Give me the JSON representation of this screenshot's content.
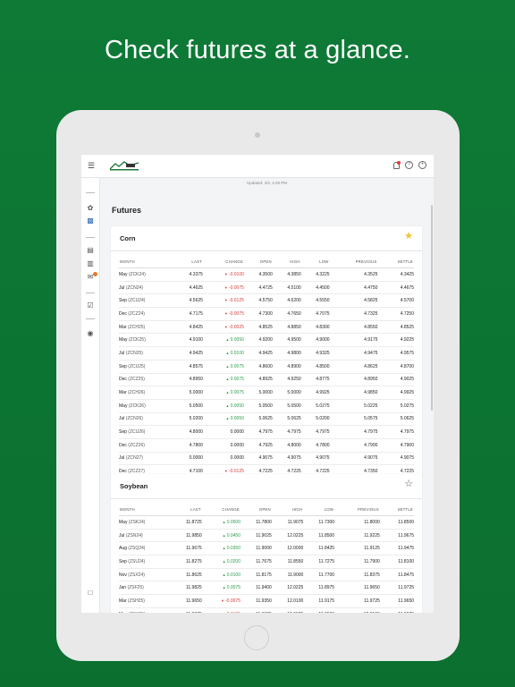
{
  "headline": "Check futures at a glance.",
  "app": {
    "updated": "Updated: 4/3, 4:29 PM",
    "page_title": "Futures",
    "logo_alt": "Daily BOSS"
  },
  "columns": [
    "MONTH",
    "LAST",
    "CHANGE",
    "OPEN",
    "HIGH",
    "LOW",
    "PREVIOUS",
    "SETTLE"
  ],
  "cards": [
    {
      "title": "Corn",
      "favorite": true,
      "rows": [
        {
          "month": "May",
          "code": "(ZCK24)",
          "last": "4.3375",
          "change": "-0.0100",
          "dir": "down",
          "open": "4.3500",
          "high": "4.3850",
          "low": "4.3225",
          "previous": "4.3525",
          "settle": "4.3425"
        },
        {
          "month": "Jul",
          "code": "(ZCN24)",
          "last": "4.4625",
          "change": "-0.0075",
          "dir": "down",
          "open": "4.4725",
          "high": "4.5100",
          "low": "4.4500",
          "previous": "4.4750",
          "settle": "4.4675"
        },
        {
          "month": "Sep",
          "code": "(ZCU24)",
          "last": "4.5625",
          "change": "-0.0125",
          "dir": "down",
          "open": "4.5750",
          "high": "4.6200",
          "low": "4.5550",
          "previous": "4.5825",
          "settle": "4.5700"
        },
        {
          "month": "Dec",
          "code": "(ZCZ24)",
          "last": "4.7175",
          "change": "-0.0075",
          "dir": "down",
          "open": "4.7300",
          "high": "4.7650",
          "low": "4.7075",
          "previous": "4.7325",
          "settle": "4.7250"
        },
        {
          "month": "Mar",
          "code": "(ZCH25)",
          "last": "4.8425",
          "change": "-0.0025",
          "dir": "down",
          "open": "4.8525",
          "high": "4.8850",
          "low": "4.8300",
          "previous": "4.8550",
          "settle": "4.8525"
        },
        {
          "month": "May",
          "code": "(ZCK25)",
          "last": "4.9100",
          "change": "0.0050",
          "dir": "up",
          "open": "4.9200",
          "high": "4.9500",
          "low": "4.9000",
          "previous": "4.9175",
          "settle": "4.9225"
        },
        {
          "month": "Jul",
          "code": "(ZCN25)",
          "last": "4.9425",
          "change": "0.0100",
          "dir": "up",
          "open": "4.9425",
          "high": "4.9800",
          "low": "4.9325",
          "previous": "4.9475",
          "settle": "4.9575"
        },
        {
          "month": "Sep",
          "code": "(ZCU25)",
          "last": "4.8575",
          "change": "0.0075",
          "dir": "up",
          "open": "4.8600",
          "high": "4.8900",
          "low": "4.8500",
          "previous": "4.8625",
          "settle": "4.8700"
        },
        {
          "month": "Dec",
          "code": "(ZCZ25)",
          "last": "4.8950",
          "change": "0.0075",
          "dir": "up",
          "open": "4.8925",
          "high": "4.9250",
          "low": "4.8775",
          "previous": "4.8950",
          "settle": "4.9025"
        },
        {
          "month": "Mar",
          "code": "(ZCH26)",
          "last": "5.0000",
          "change": "0.0075",
          "dir": "up",
          "open": "5.0000",
          "high": "5.0000",
          "low": "4.9925",
          "previous": "4.9850",
          "settle": "4.9925"
        },
        {
          "month": "May",
          "code": "(ZCK26)",
          "last": "5.0500",
          "change": "0.0050",
          "dir": "up",
          "open": "5.0500",
          "high": "5.0500",
          "low": "5.0275",
          "previous": "5.0225",
          "settle": "5.0275"
        },
        {
          "month": "Jul",
          "code": "(ZCN26)",
          "last": "5.0200",
          "change": "0.0050",
          "dir": "up",
          "open": "5.0625",
          "high": "5.0625",
          "low": "5.0200",
          "previous": "5.0575",
          "settle": "5.0625"
        },
        {
          "month": "Sep",
          "code": "(ZCU26)",
          "last": "4.8000",
          "change": "0.0000",
          "dir": "flat",
          "open": "4.7975",
          "high": "4.7975",
          "low": "4.7975",
          "previous": "4.7975",
          "settle": "4.7975"
        },
        {
          "month": "Dec",
          "code": "(ZCZ26)",
          "last": "4.7800",
          "change": "0.0000",
          "dir": "flat",
          "open": "4.7925",
          "high": "4.8000",
          "low": "4.7800",
          "previous": "4.7900",
          "settle": "4.7900"
        },
        {
          "month": "Jul",
          "code": "(ZCN27)",
          "last": "0.0000",
          "change": "0.0000",
          "dir": "flat",
          "open": "4.9075",
          "high": "4.9075",
          "low": "4.9075",
          "previous": "4.9075",
          "settle": "4.9075"
        },
        {
          "month": "Dec",
          "code": "(ZCZ27)",
          "last": "4.7100",
          "change": "-0.0125",
          "dir": "down",
          "open": "4.7225",
          "high": "4.7225",
          "low": "4.7225",
          "previous": "4.7350",
          "settle": "4.7225"
        }
      ]
    },
    {
      "title": "Soybean",
      "favorite": false,
      "rows": [
        {
          "month": "May",
          "code": "(ZSK24)",
          "last": "11.8725",
          "change": "0.0500",
          "dir": "up",
          "open": "11.7800",
          "high": "11.9075",
          "low": "11.7300",
          "previous": "11.8000",
          "settle": "11.8500"
        },
        {
          "month": "Jul",
          "code": "(ZSN24)",
          "last": "11.9850",
          "change": "0.0450",
          "dir": "up",
          "open": "11.9025",
          "high": "12.0225",
          "low": "11.8500",
          "previous": "11.9225",
          "settle": "11.9675"
        },
        {
          "month": "Aug",
          "code": "(ZSQ24)",
          "last": "11.9675",
          "change": "0.0350",
          "dir": "up",
          "open": "11.9000",
          "high": "12.0000",
          "low": "11.8425",
          "previous": "11.9125",
          "settle": "11.9475"
        },
        {
          "month": "Sep",
          "code": "(ZSU24)",
          "last": "11.8275",
          "change": "0.0200",
          "dir": "up",
          "open": "11.7675",
          "high": "11.8550",
          "low": "11.7275",
          "previous": "11.7900",
          "settle": "11.8100"
        },
        {
          "month": "Nov",
          "code": "(ZSX24)",
          "last": "11.8625",
          "change": "0.0100",
          "dir": "up",
          "open": "11.8175",
          "high": "11.9000",
          "low": "11.7700",
          "previous": "11.8375",
          "settle": "11.8475"
        },
        {
          "month": "Jan",
          "code": "(ZSF25)",
          "last": "11.9825",
          "change": "0.0075",
          "dir": "up",
          "open": "11.9400",
          "high": "12.0225",
          "low": "11.8975",
          "previous": "11.9650",
          "settle": "11.9725"
        },
        {
          "month": "Mar",
          "code": "(ZSH25)",
          "last": "11.9650",
          "change": "-0.0075",
          "dir": "down",
          "open": "11.9350",
          "high": "12.0100",
          "low": "11.9175",
          "previous": "11.9725",
          "settle": "11.9650"
        },
        {
          "month": "May",
          "code": "(ZSK25)",
          "last": "11.9875",
          "change": "-0.0125",
          "dir": "down",
          "open": "11.9925",
          "high": "12.0325",
          "low": "11.9500",
          "previous": "12.0100",
          "settle": "11.9975"
        }
      ]
    }
  ],
  "colors": {
    "background": "#0e7a36",
    "up": "#2e9d4e",
    "down": "#d93c3c",
    "star": "#f2c32c",
    "accent": "#2a6cb0"
  },
  "icons": {
    "menu": "hamburger-icon",
    "notifications": "bell-icon",
    "help": "help-icon",
    "account": "user-icon"
  }
}
